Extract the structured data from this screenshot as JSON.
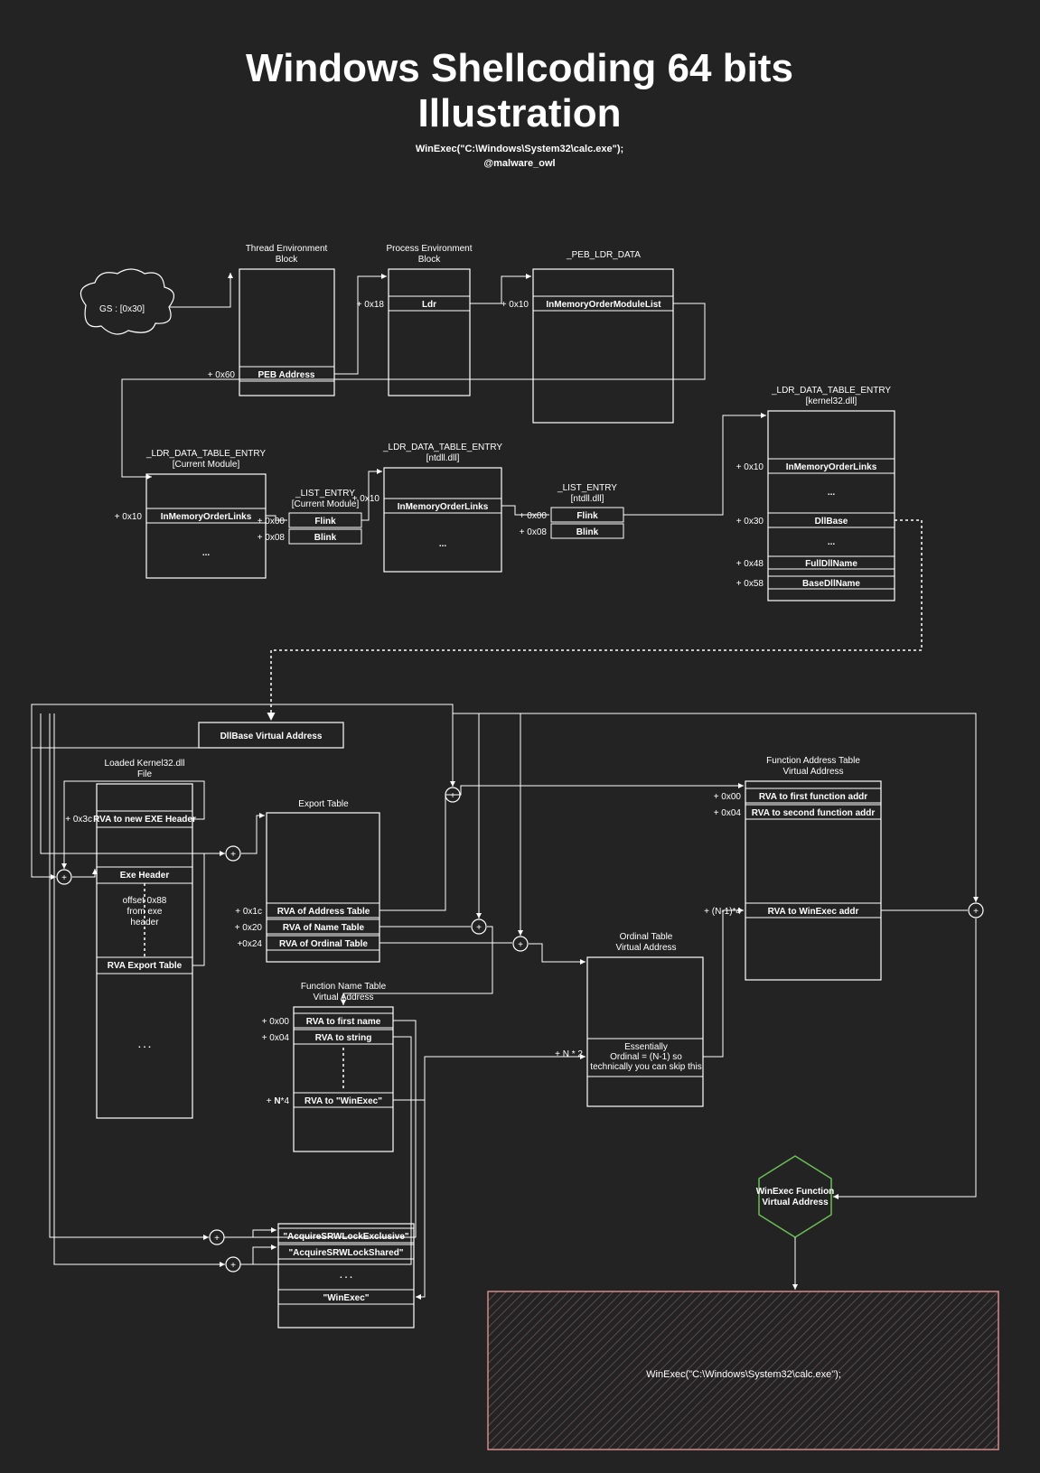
{
  "title_line1": "Windows Shellcoding 64 bits",
  "title_line2": "Illustration",
  "subtitle": "WinExec(\"C:\\Windows\\System32\\calc.exe\");",
  "author": "@malware_owl",
  "gs_label": "GS :  [0x30]",
  "teb": {
    "title1": "Thread Environment",
    "title2": "Block",
    "offset_peb": "+ 0x60",
    "field_peb": "PEB Address"
  },
  "peb": {
    "title1": "Process Environment",
    "title2": "Block",
    "offset_ldr": "+ 0x18",
    "field_ldr": "Ldr"
  },
  "peb_ldr": {
    "title": "_PEB_LDR_DATA",
    "offset": "+ 0x10",
    "field": "InMemoryOrderModuleList"
  },
  "ldte_kernel32": {
    "title1": "_LDR_DATA_TABLE_ENTRY",
    "title2": "[kernel32.dll]",
    "off1": "+ 0x10",
    "f1": "InMemoryOrderLinks",
    "dots": "...",
    "off2": "+ 0x30",
    "f2": "DllBase",
    "dots2": "...",
    "off3": "+ 0x48",
    "f3": "FullDllName",
    "off4": "+ 0x58",
    "f4": "BaseDllName"
  },
  "ldte_current": {
    "title1": "_LDR_DATA_TABLE_ENTRY",
    "title2": "[Current Module]",
    "off": "+ 0x10",
    "f": "InMemoryOrderLinks",
    "dots": "..."
  },
  "list_current": {
    "title1": "_LIST_ENTRY",
    "title2": "[Current Module]",
    "off1": "+ 0x00",
    "f1": "Flink",
    "off2": "+ 0x08",
    "f2": "Blink"
  },
  "ldte_ntdll": {
    "title1": "_LDR_DATA_TABLE_ENTRY",
    "title2": "[ntdll.dll]",
    "off": "+ 0x10",
    "f": "InMemoryOrderLinks",
    "dots": "..."
  },
  "list_ntdll": {
    "title1": "_LIST_ENTRY",
    "title2": "[ntdll.dll]",
    "off1": "+ 0x00",
    "f1": "Flink",
    "off2": "+ 0x08",
    "f2": "Blink"
  },
  "dllbase_va": "DllBase Virtual Address",
  "loaded_k32": {
    "title1": "Loaded  Kernel32.dll",
    "title2": "File",
    "off_rva_exe": "+ 0x3c",
    "rva_exe": "RVA to new EXE Header",
    "exe_header": "Exe Header",
    "note1": "offset 0x88",
    "note2": "from exe",
    "note3": "header",
    "rva_export": "RVA Export Table",
    "dots": ". . ."
  },
  "export_table": {
    "title": "Export Table",
    "off1": "+ 0x1c",
    "f1": "RVA of Address Table",
    "off2": "+ 0x20",
    "f2": "RVA of Name Table",
    "off3": "+0x24",
    "f3": "RVA of Ordinal Table"
  },
  "func_name_table": {
    "title1": "Function Name Table",
    "title2": "Virtual Address",
    "off1": "+ 0x00",
    "f1": "RVA to first name",
    "off2": "+ 0x04",
    "f2": "RVA to string",
    "off3_prefix": "+ ",
    "off3_bold": "N",
    "off3_suffix": "*4",
    "f3": "RVA to \"WinExec\""
  },
  "func_addr_table": {
    "title1": "Function Address Table",
    "title2": "Virtual Address",
    "off1": "+ 0x00",
    "f1": "RVA to first function addr",
    "off2": "+ 0x04",
    "f2": "RVA to second function addr",
    "off3": "+ (N-1)*4",
    "f3": "RVA to WinExec addr"
  },
  "ordinal_table": {
    "title1": "Ordinal Table",
    "title2": "Virtual Address",
    "off": "+ N * 2",
    "note1": "Essentially",
    "note2": "Ordinal = (N-1) so",
    "note3": "technically you can skip this"
  },
  "name_strings": {
    "s1": "\"AcquireSRWLockExclusive\"",
    "s2": "\"AcquireSRWLockShared\"",
    "dots": ". . .",
    "s3": "\"WinExec\""
  },
  "result": {
    "line1": "WinExec Function",
    "line2": "Virtual Address"
  },
  "final": "WinExec(\"C:\\Windows\\System32\\calc.exe\");"
}
